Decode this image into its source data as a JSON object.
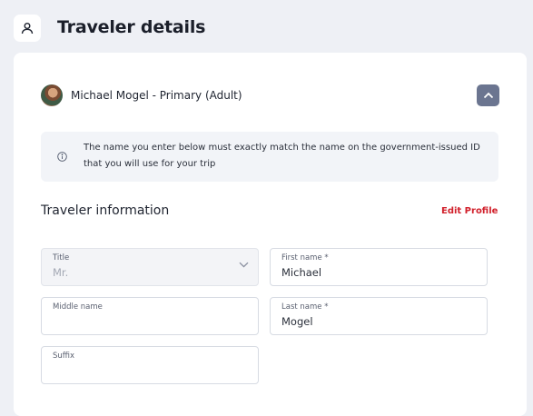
{
  "header": {
    "title": "Traveler details",
    "icon": "user-icon"
  },
  "traveler": {
    "name": "Michael Mogel - Primary (Adult)",
    "avatar": "avatar-photo",
    "toggle_icon": "chevron-up-icon"
  },
  "notice": {
    "icon": "info-icon",
    "text": "The name you enter below must exactly match the name on the government-issued ID that you will use for your trip"
  },
  "section": {
    "title": "Traveler information",
    "edit_label": "Edit Profile"
  },
  "form": {
    "title": {
      "label": "Title",
      "value": "Mr."
    },
    "first_name": {
      "label": "First name *",
      "value": "Michael"
    },
    "middle_name": {
      "label": "Middle name",
      "value": ""
    },
    "last_name": {
      "label": "Last name *",
      "value": "Mogel"
    },
    "suffix": {
      "label": "Suffix",
      "value": ""
    }
  },
  "colors": {
    "accent_red": "#d11f2a",
    "toggle_bg": "#6b7590",
    "page_bg": "#eef0f5"
  }
}
